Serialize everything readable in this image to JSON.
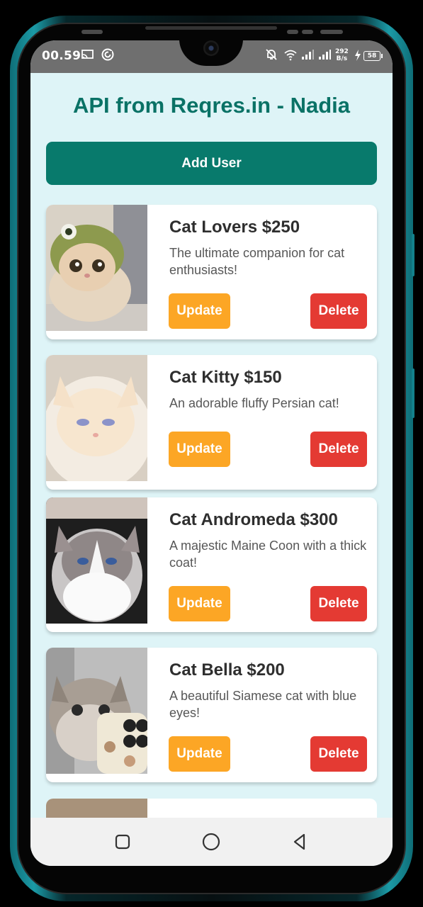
{
  "status_bar": {
    "time": "00.59",
    "net_speed_value": "292",
    "net_speed_unit": "B/s",
    "battery": "58"
  },
  "app": {
    "title": "API from Reqres.in - Nadia",
    "add_user_label": "Add User",
    "update_label": "Update",
    "delete_label": "Delete"
  },
  "cards": [
    {
      "name": "Cat Lovers $250",
      "description": "The ultimate companion for cat enthusiasts!"
    },
    {
      "name": "Cat Kitty $150",
      "description": "An adorable fluffy Persian cat!"
    },
    {
      "name": "Cat Andromeda $300",
      "description": "A majestic Maine Coon with a thick coat!"
    },
    {
      "name": "Cat Bella $200",
      "description": "A beautiful Siamese cat with blue eyes!"
    }
  ],
  "colors": {
    "background": "#def4f7",
    "title": "#0a7266",
    "add_user": "#087a6c",
    "update": "#fca625",
    "delete": "#e43a33"
  },
  "icons": {
    "status_left": [
      "screen-cast-icon",
      "sync-icon"
    ],
    "status_right": [
      "bell-off-icon",
      "wifi-icon",
      "signal-icon",
      "signal-icon",
      "charging-icon"
    ],
    "nav": [
      "recents-icon",
      "home-icon",
      "back-icon"
    ]
  }
}
